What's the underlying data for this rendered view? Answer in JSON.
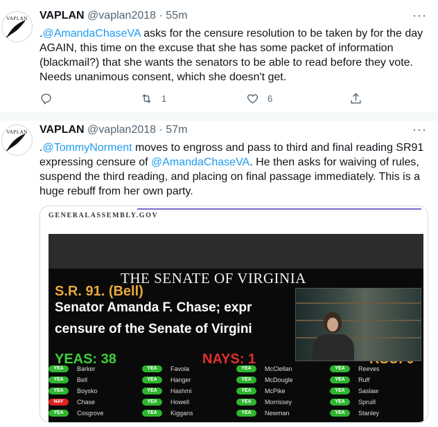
{
  "tweets": [
    {
      "avatar_text": "VAPLAN",
      "name": "VAPLAN",
      "handle": "@vaplan2018",
      "dot": "·",
      "time": "55m",
      "more": "···",
      "body_pre": ".",
      "mention1": "@AmandaChaseVA",
      "body_rest": " asks for the censure resolution to be taken by for the day AGAIN, this time on the excuse that she has some packet of information (blackmail?) that she wants the senators to be able to read before they vote. Needs unanimous consent, which she doesn't get.",
      "retweet_count": "1",
      "like_count": "6"
    },
    {
      "avatar_text": "VAPLAN",
      "name": "VAPLAN",
      "handle": "@vaplan2018",
      "dot": "·",
      "time": "57m",
      "more": "···",
      "body_pre": ".",
      "mention1": "@TommyNorment",
      "body_mid": " moves to engross and pass to third and final reading SR91 expressing censure of ",
      "mention2": "@AmandaChaseVA",
      "body_rest": ". He then asks for waiving of rules, suspend the third reading, and placing on final passage immediately. This is a huge rebuff from her own party."
    }
  ],
  "media": {
    "site": "GENERALASSEMBLY.GOV",
    "chamber": "THE SENATE OF VIRGINIA",
    "resolution": "S.R. 91. (Bell)",
    "subject_line1": "Senator Amanda F. Chase; expr",
    "subject_line2": "censure of the Senate of Virgini",
    "yeas": "YEAS: 38",
    "nays": "NAYS: 1",
    "other": "RSU. 0",
    "yea_label": "YEA",
    "nay_label": "NAY",
    "votes": [
      [
        {
          "name": "Barker",
          "v": "YEA"
        },
        {
          "name": "Favola",
          "v": "YEA"
        },
        {
          "name": "McClellan",
          "v": "YEA"
        },
        {
          "name": "Reeves",
          "v": "YEA"
        }
      ],
      [
        {
          "name": "Bell",
          "v": "YEA"
        },
        {
          "name": "Hanger",
          "v": "YEA"
        },
        {
          "name": "McDougle",
          "v": "YEA"
        },
        {
          "name": "Ruff",
          "v": "YEA"
        }
      ],
      [
        {
          "name": "Boysko",
          "v": "YEA"
        },
        {
          "name": "Hashmi",
          "v": "YEA"
        },
        {
          "name": "McPike",
          "v": "YEA"
        },
        {
          "name": "Saslaw",
          "v": "YEA"
        }
      ],
      [
        {
          "name": "Chase",
          "v": "NAY"
        },
        {
          "name": "Howell",
          "v": "YEA"
        },
        {
          "name": "Morrissey",
          "v": "YEA"
        },
        {
          "name": "Spruill",
          "v": "YEA"
        }
      ],
      [
        {
          "name": "Cosgrove",
          "v": "YEA"
        },
        {
          "name": "Kiggans",
          "v": "YEA"
        },
        {
          "name": "Newman",
          "v": "YEA"
        },
        {
          "name": "Stanley",
          "v": "YEA"
        }
      ]
    ]
  },
  "icons": [
    "reply-icon",
    "retweet-icon",
    "like-icon",
    "share-icon",
    "more-icon"
  ],
  "colors": {
    "link": "#1d9bf0",
    "muted": "#536471",
    "yea": "#2fb52f",
    "nay": "#dd2222"
  }
}
